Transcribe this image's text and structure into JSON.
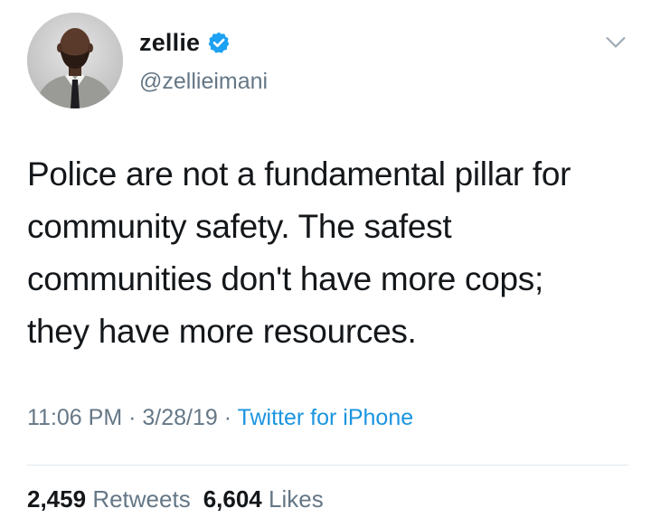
{
  "author": {
    "display_name": "zellie",
    "handle": "@zellieimani",
    "verified": true,
    "verified_icon": "verified-badge-icon",
    "avatar": "avatar-photo"
  },
  "tweet": {
    "text": "Police are not a fundamental pillar for\ncommunity safety. The safest\ncommunities don't have more cops;\nthey have more resources."
  },
  "meta": {
    "time": "11:06 PM",
    "separator": "·",
    "date": "3/28/19",
    "source": "Twitter for iPhone"
  },
  "stats": {
    "retweets_count": "2,459",
    "retweets_label": "Retweets",
    "likes_count": "6,604",
    "likes_label": "Likes"
  },
  "menu_icon": "chevron-down-icon",
  "colors": {
    "primary_text": "#14171a",
    "secondary_text": "#657786",
    "link": "#1b95e0",
    "verified_blue": "#1da1f2",
    "divider": "#e1e8ed"
  }
}
